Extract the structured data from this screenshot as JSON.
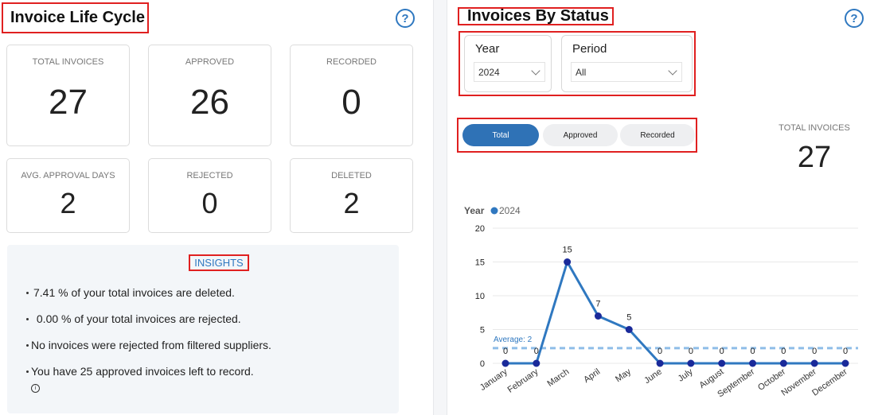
{
  "left_panel": {
    "title": "Invoice Life Cycle",
    "help_icon": "?",
    "stats": [
      {
        "label": "TOTAL INVOICES",
        "value": "27"
      },
      {
        "label": "APPROVED",
        "value": "26"
      },
      {
        "label": "RECORDED",
        "value": "0"
      },
      {
        "label": "AVG. APPROVAL DAYS",
        "value": "2"
      },
      {
        "label": "REJECTED",
        "value": "0"
      },
      {
        "label": "DELETED",
        "value": "2"
      }
    ],
    "insights": {
      "title": "INSIGHTS",
      "items": [
        "7.41 % of your total invoices are deleted.",
        " 0.00 % of your total invoices are rejected.",
        "No invoices were rejected from filtered suppliers.",
        "You have 25 approved invoices left to record."
      ],
      "info_icon": "i"
    }
  },
  "right_panel": {
    "title": "Invoices By Status",
    "help_icon": "?",
    "filters": {
      "year": {
        "label": "Year",
        "value": "2024"
      },
      "period": {
        "label": "Period",
        "value": "All"
      }
    },
    "toggles": [
      {
        "label": "Total",
        "active": true
      },
      {
        "label": "Approved",
        "active": false
      },
      {
        "label": "Recorded",
        "active": false
      }
    ],
    "total_label": "TOTAL INVOICES",
    "total_value": "27"
  },
  "chart_data": {
    "type": "line",
    "title": "",
    "legend_title": "Year",
    "legend_placement": "top-left",
    "categories": [
      "January",
      "February",
      "March",
      "April",
      "May",
      "June",
      "July",
      "August",
      "September",
      "October",
      "November",
      "December"
    ],
    "series": [
      {
        "name": "2024",
        "values": [
          0,
          0,
          15,
          7,
          5,
          0,
          0,
          0,
          0,
          0,
          0,
          0
        ],
        "color": "#2f78c0",
        "marker_color": "#1a2a9a"
      }
    ],
    "yticks": [
      0,
      5,
      10,
      15,
      20
    ],
    "ylim": [
      0,
      20
    ],
    "grid": true,
    "average": {
      "label": "Average: 2",
      "value": 2.25,
      "color": "#8fbde8"
    },
    "xlabel": "",
    "ylabel": ""
  }
}
